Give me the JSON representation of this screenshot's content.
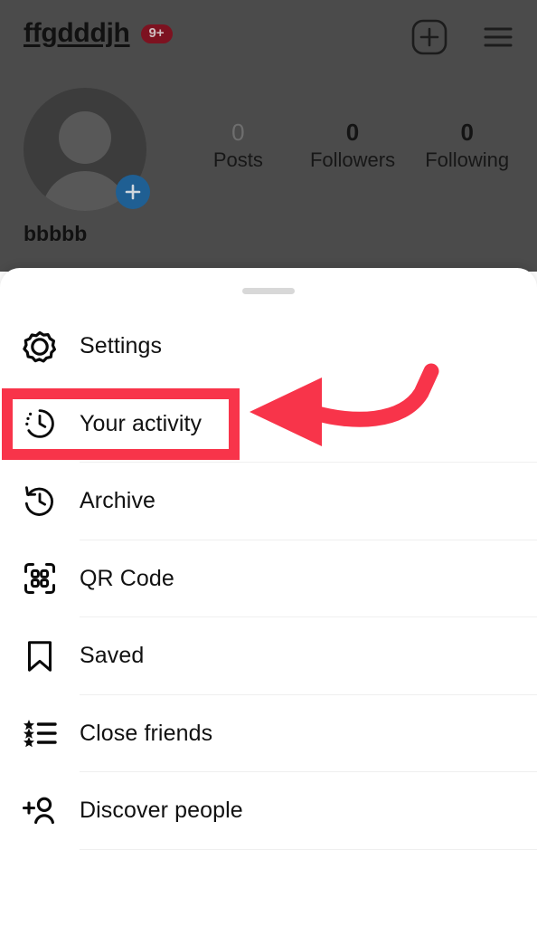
{
  "header": {
    "username": "ffgdddjh",
    "notification_badge": "9+",
    "add_icon": "plus-square-icon",
    "menu_icon": "hamburger-menu-icon"
  },
  "profile": {
    "avatar_icon": "default-avatar-icon",
    "avatar_add_icon": "add-story-plus-icon",
    "display_name": "bbbbb",
    "stats": [
      {
        "value": "0",
        "label": "Posts"
      },
      {
        "value": "0",
        "label": "Followers"
      },
      {
        "value": "0",
        "label": "Following"
      }
    ]
  },
  "sheet": {
    "drag_handle": "drag-handle",
    "items": [
      {
        "label": "Settings",
        "icon": "gear-icon"
      },
      {
        "label": "Your activity",
        "icon": "clock-activity-icon"
      },
      {
        "label": "Archive",
        "icon": "archive-clock-back-icon"
      },
      {
        "label": "QR Code",
        "icon": "qr-code-icon"
      },
      {
        "label": "Saved",
        "icon": "bookmark-icon"
      },
      {
        "label": "Close friends",
        "icon": "star-list-icon"
      },
      {
        "label": "Discover people",
        "icon": "person-add-icon"
      }
    ]
  },
  "annotation": {
    "highlight_target": "Your activity",
    "highlight_color": "#f8344a",
    "arrow_color": "#f8344a",
    "arrow_direction": "left"
  },
  "colors": {
    "accent_red": "#f8344a",
    "badge_red": "#7d1220",
    "avatar_plus_blue": "#1f5f93",
    "sheet_background": "#ffffff",
    "dim_background": "#4b4b4b"
  }
}
